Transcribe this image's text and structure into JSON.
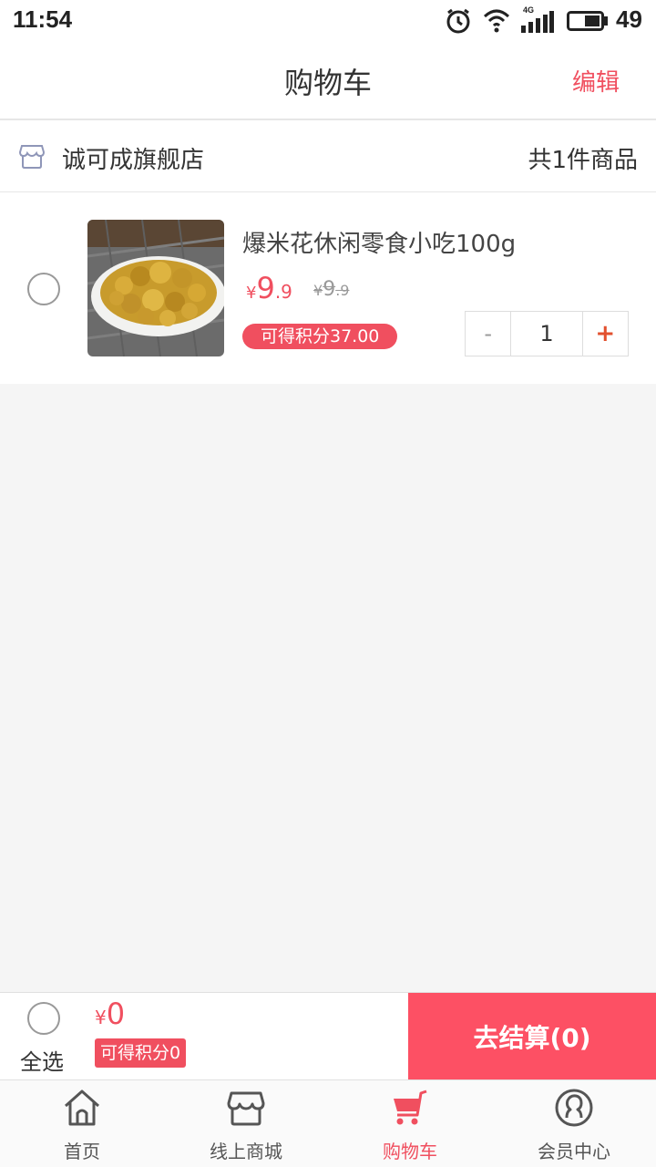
{
  "status_bar": {
    "time": "11:54",
    "network": "4G",
    "battery": "49",
    "icons": [
      "alarm-icon",
      "wifi-icon",
      "signal-icon",
      "battery-icon"
    ]
  },
  "header": {
    "title": "购物车",
    "edit_label": "编辑"
  },
  "store": {
    "name": "诚可成旗舰店",
    "count_text": "共1件商品",
    "icon": "store-icon"
  },
  "item": {
    "title": "爆米花休闲零食小吃100g",
    "price_symbol": "¥",
    "price_int": "9",
    "price_dec": ".9",
    "original_symbol": "¥",
    "original_int": "9",
    "original_dec": ".9",
    "points_text": "可得积分37.00",
    "quantity": "1",
    "minus_label": "-",
    "plus_label": "+",
    "checked": false
  },
  "checkout": {
    "select_all_label": "全选",
    "total_symbol": "¥",
    "total_amount": "0",
    "points_text": "可得积分0",
    "button_label": "去结算(0)"
  },
  "tabs": [
    {
      "label": "首页",
      "icon": "home-icon",
      "active": false
    },
    {
      "label": "线上商城",
      "icon": "shop-icon",
      "active": false
    },
    {
      "label": "购物车",
      "icon": "cart-icon",
      "active": true
    },
    {
      "label": "会员中心",
      "icon": "member-icon",
      "active": false
    }
  ],
  "colors": {
    "accent": "#f04f5f",
    "checkout_button": "#fd5064",
    "background": "#f5f5f5"
  }
}
